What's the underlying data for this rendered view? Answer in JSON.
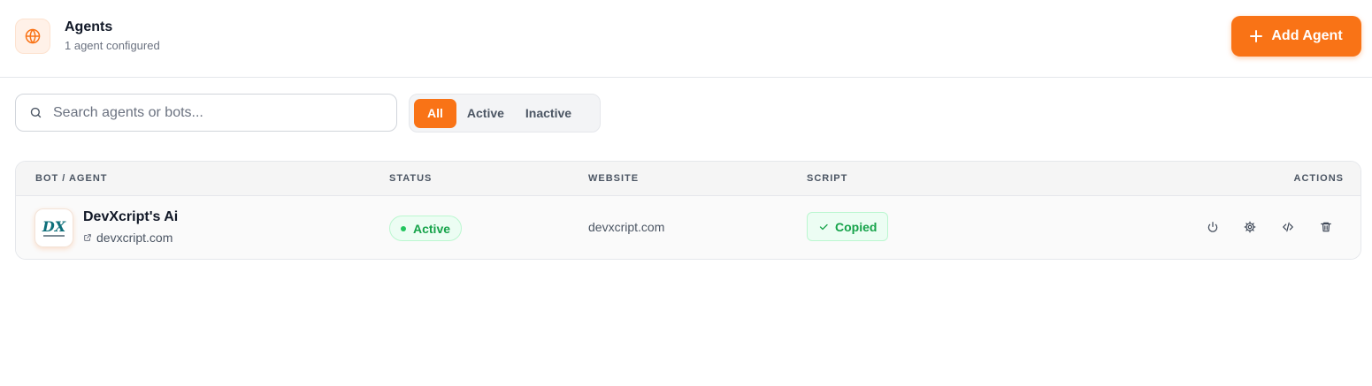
{
  "header": {
    "title": "Agents",
    "subtitle": "1 agent configured",
    "icon": "globe-icon",
    "add_button_label": "Add Agent",
    "accent_color": "#f97316"
  },
  "search": {
    "placeholder": "Search agents or bots...",
    "value": ""
  },
  "filters": {
    "options": [
      "All",
      "Active",
      "Inactive"
    ],
    "selected": "All"
  },
  "table": {
    "columns": [
      "BOT / AGENT",
      "STATUS",
      "WEBSITE",
      "SCRIPT",
      "ACTIONS"
    ],
    "rows": [
      {
        "name": "DevXcript's Ai",
        "link": "devxcript.com",
        "logo_text": "DX",
        "status": "Active",
        "website": "devxcript.com",
        "script": "Copied",
        "actions": [
          "power-icon",
          "settings-icon",
          "code-icon",
          "trash-icon"
        ]
      }
    ]
  }
}
